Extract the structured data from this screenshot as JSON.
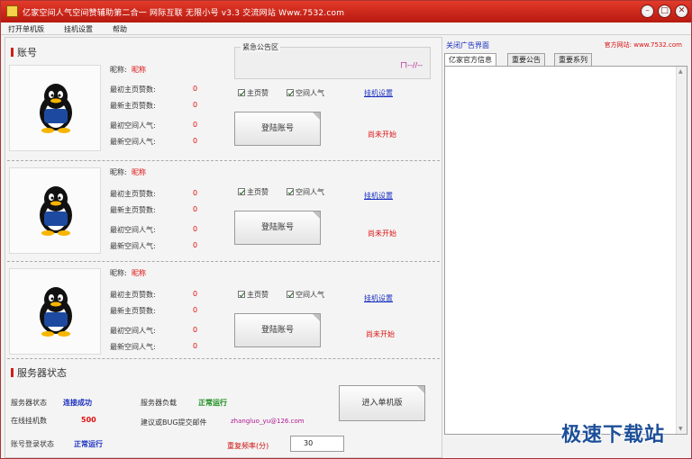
{
  "window": {
    "title": "亿家空间人气空间赞辅助第二合一   网际互联 无限小号   v3.3   交流网站 Www.7532.com",
    "minimize_glyph": "–",
    "restore_glyph": "□",
    "close_glyph": "✕"
  },
  "menu": {
    "items": [
      "打开单机版",
      "挂机设置",
      "帮助"
    ]
  },
  "left": {
    "account_section": "账号",
    "announce_title": "紧急公告区",
    "announce_text": "ㄇ--//--",
    "accounts": [
      {
        "nick_label": "昵称:",
        "nick_value": "昵称",
        "l1": "最初主页赞数:",
        "v1": "0",
        "l2": "最新主页赞数:",
        "v2": "0",
        "l3": "最初空间人气:",
        "v3": "0",
        "l4": "最新空间人气:",
        "v4": "0",
        "chk1": "主页赞",
        "chk2": "空间人气",
        "link": "挂机设置",
        "button": "登陆账号",
        "status": "尚未开始"
      },
      {
        "nick_label": "昵称:",
        "nick_value": "昵称",
        "l1": "最初主页赞数:",
        "v1": "0",
        "l2": "最新主页赞数:",
        "v2": "0",
        "l3": "最初空间人气:",
        "v3": "0",
        "l4": "最新空间人气:",
        "v4": "0",
        "chk1": "主页赞",
        "chk2": "空间人气",
        "link": "挂机设置",
        "button": "登陆账号",
        "status": "尚未开始"
      },
      {
        "nick_label": "昵称:",
        "nick_value": "昵称",
        "l1": "最初主页赞数:",
        "v1": "0",
        "l2": "最新主页赞数:",
        "v2": "0",
        "l3": "最初空间人气:",
        "v3": "0",
        "l4": "最新空间人气:",
        "v4": "0",
        "chk1": "主页赞",
        "chk2": "空间人气",
        "link": "挂机设置",
        "button": "登陆账号",
        "status": "尚未开始"
      }
    ],
    "server_section": "服务器状态",
    "server_status_label": "服务器状态",
    "server_status_value": "连接成功",
    "server_load_label": "服务器负载",
    "server_load_value": "正常运行",
    "online_label": "在线挂机数",
    "online_value": "500",
    "mail_label": "建议或BUG提交邮件",
    "mail_value": "zhangluo_yu@126.com",
    "account_status_label": "账号登录状态",
    "account_status_value": "正常运行",
    "enter_button": "进入单机版",
    "freq_label": "重复频率(分)",
    "freq_value": "30"
  },
  "right": {
    "ad_title": "关闭广告界面",
    "official_site": "官方网站: www.7532.com",
    "tabs": [
      "亿家官方信息",
      "重要公告",
      "重要系列"
    ]
  },
  "watermark": "极速下载站"
}
